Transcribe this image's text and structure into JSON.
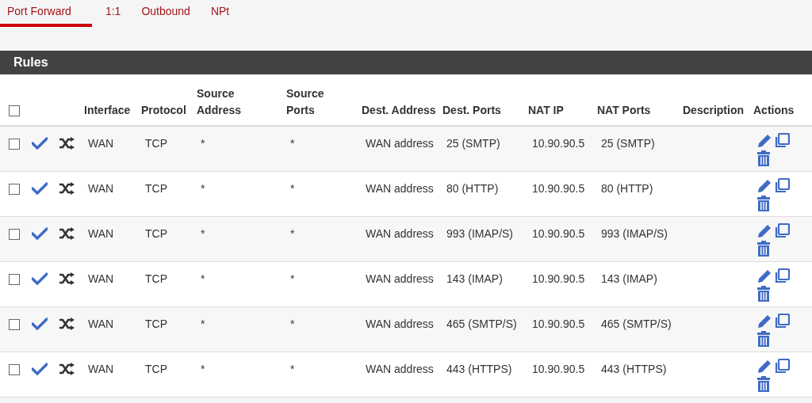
{
  "tabs": [
    {
      "label": "Port Forward",
      "selected": true
    },
    {
      "label": "1:1",
      "selected": false
    },
    {
      "label": "Outbound",
      "selected": false
    },
    {
      "label": "NPt",
      "selected": false
    }
  ],
  "panel": {
    "title": "Rules"
  },
  "table": {
    "select_all_checked": false,
    "columns": [
      "Interface",
      "Protocol",
      "Source Address",
      "Source Ports",
      "Dest. Address",
      "Dest. Ports",
      "NAT IP",
      "NAT Ports",
      "Description",
      "Actions"
    ],
    "rows": [
      {
        "checked": false,
        "enabled": true,
        "interface": "WAN",
        "protocol": "TCP",
        "source_address": "*",
        "source_ports": "*",
        "dest_address": "WAN address",
        "dest_ports": "25 (SMTP)",
        "nat_ip": "10.90.90.5",
        "nat_ports": "25 (SMTP)"
      },
      {
        "checked": false,
        "enabled": true,
        "interface": "WAN",
        "protocol": "TCP",
        "source_address": "*",
        "source_ports": "*",
        "dest_address": "WAN address",
        "dest_ports": "80 (HTTP)",
        "nat_ip": "10.90.90.5",
        "nat_ports": "80 (HTTP)"
      },
      {
        "checked": false,
        "enabled": true,
        "interface": "WAN",
        "protocol": "TCP",
        "source_address": "*",
        "source_ports": "*",
        "dest_address": "WAN address",
        "dest_ports": "993 (IMAP/S)",
        "nat_ip": "10.90.90.5",
        "nat_ports": "993 (IMAP/S)"
      },
      {
        "checked": false,
        "enabled": true,
        "interface": "WAN",
        "protocol": "TCP",
        "source_address": "*",
        "source_ports": "*",
        "dest_address": "WAN address",
        "dest_ports": "143 (IMAP)",
        "nat_ip": "10.90.90.5",
        "nat_ports": "143 (IMAP)"
      },
      {
        "checked": false,
        "enabled": true,
        "interface": "WAN",
        "protocol": "TCP",
        "source_address": "*",
        "source_ports": "*",
        "dest_address": "WAN address",
        "dest_ports": "465 (SMTP/S)",
        "nat_ip": "10.90.90.5",
        "nat_ports": "465 (SMTP/S)"
      },
      {
        "checked": false,
        "enabled": true,
        "interface": "WAN",
        "protocol": "TCP",
        "source_address": "*",
        "source_ports": "*",
        "dest_address": "WAN address",
        "dest_ports": "443 (HTTPS)",
        "nat_ip": "10.90.90.5",
        "nat_ports": "443 (HTTPS)"
      }
    ]
  }
}
